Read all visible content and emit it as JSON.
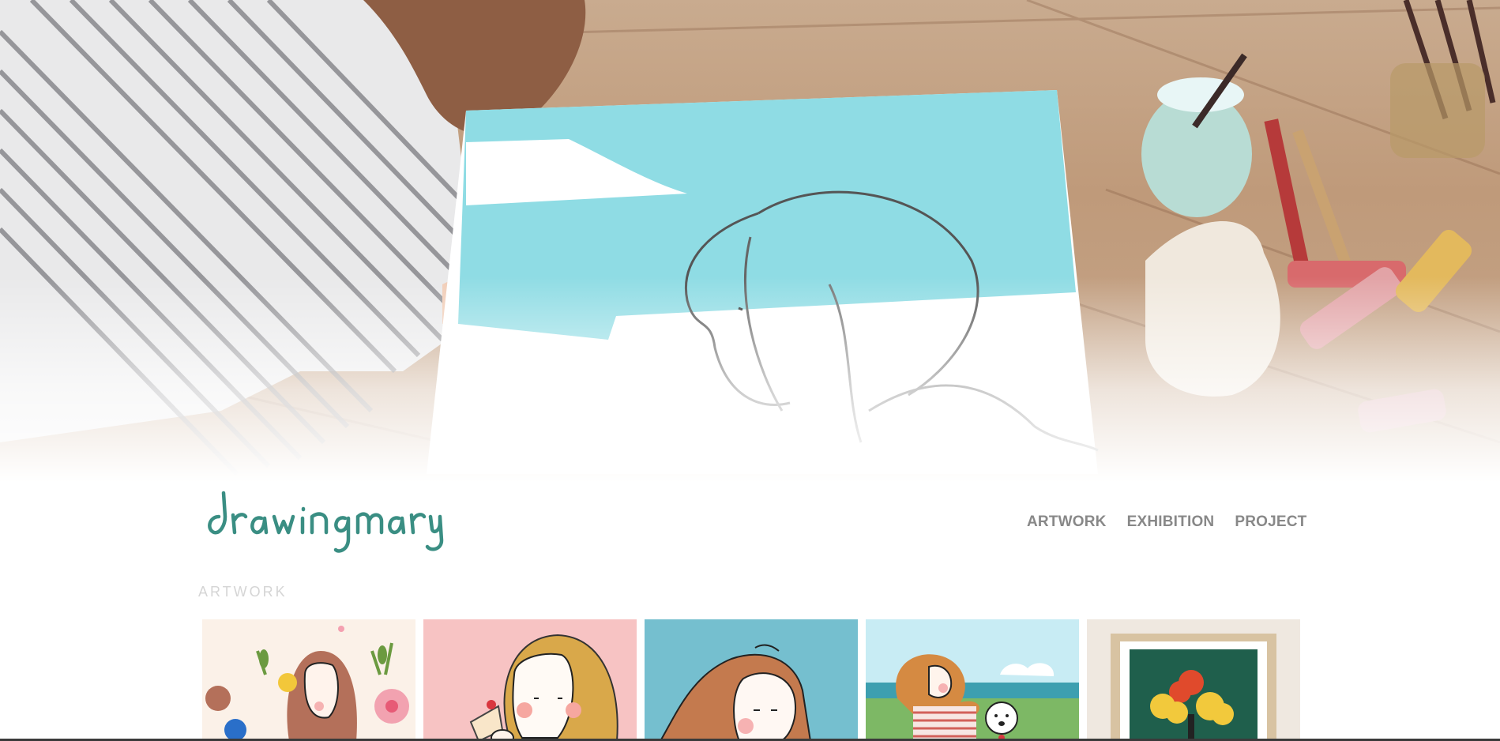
{
  "site": {
    "logo_text": "drawingmary",
    "brand_color": "#3a8e83"
  },
  "nav": {
    "items": [
      {
        "label": "ARTWORK"
      },
      {
        "label": "EXHIBITION"
      },
      {
        "label": "PROJECT"
      }
    ]
  },
  "main": {
    "section_title": "ARTWORK",
    "gallery": [
      {
        "name": "artwork-flowers-portrait",
        "bg": "#fbf1e8"
      },
      {
        "name": "artwork-cake-portrait",
        "bg": "#f7c3c3"
      },
      {
        "name": "artwork-blue-portrait",
        "bg": "#75bfcf"
      },
      {
        "name": "artwork-seaside-dog",
        "bg": "#c8ecf4"
      },
      {
        "name": "artwork-framed-tree",
        "bg": "#efe8e0"
      }
    ]
  }
}
